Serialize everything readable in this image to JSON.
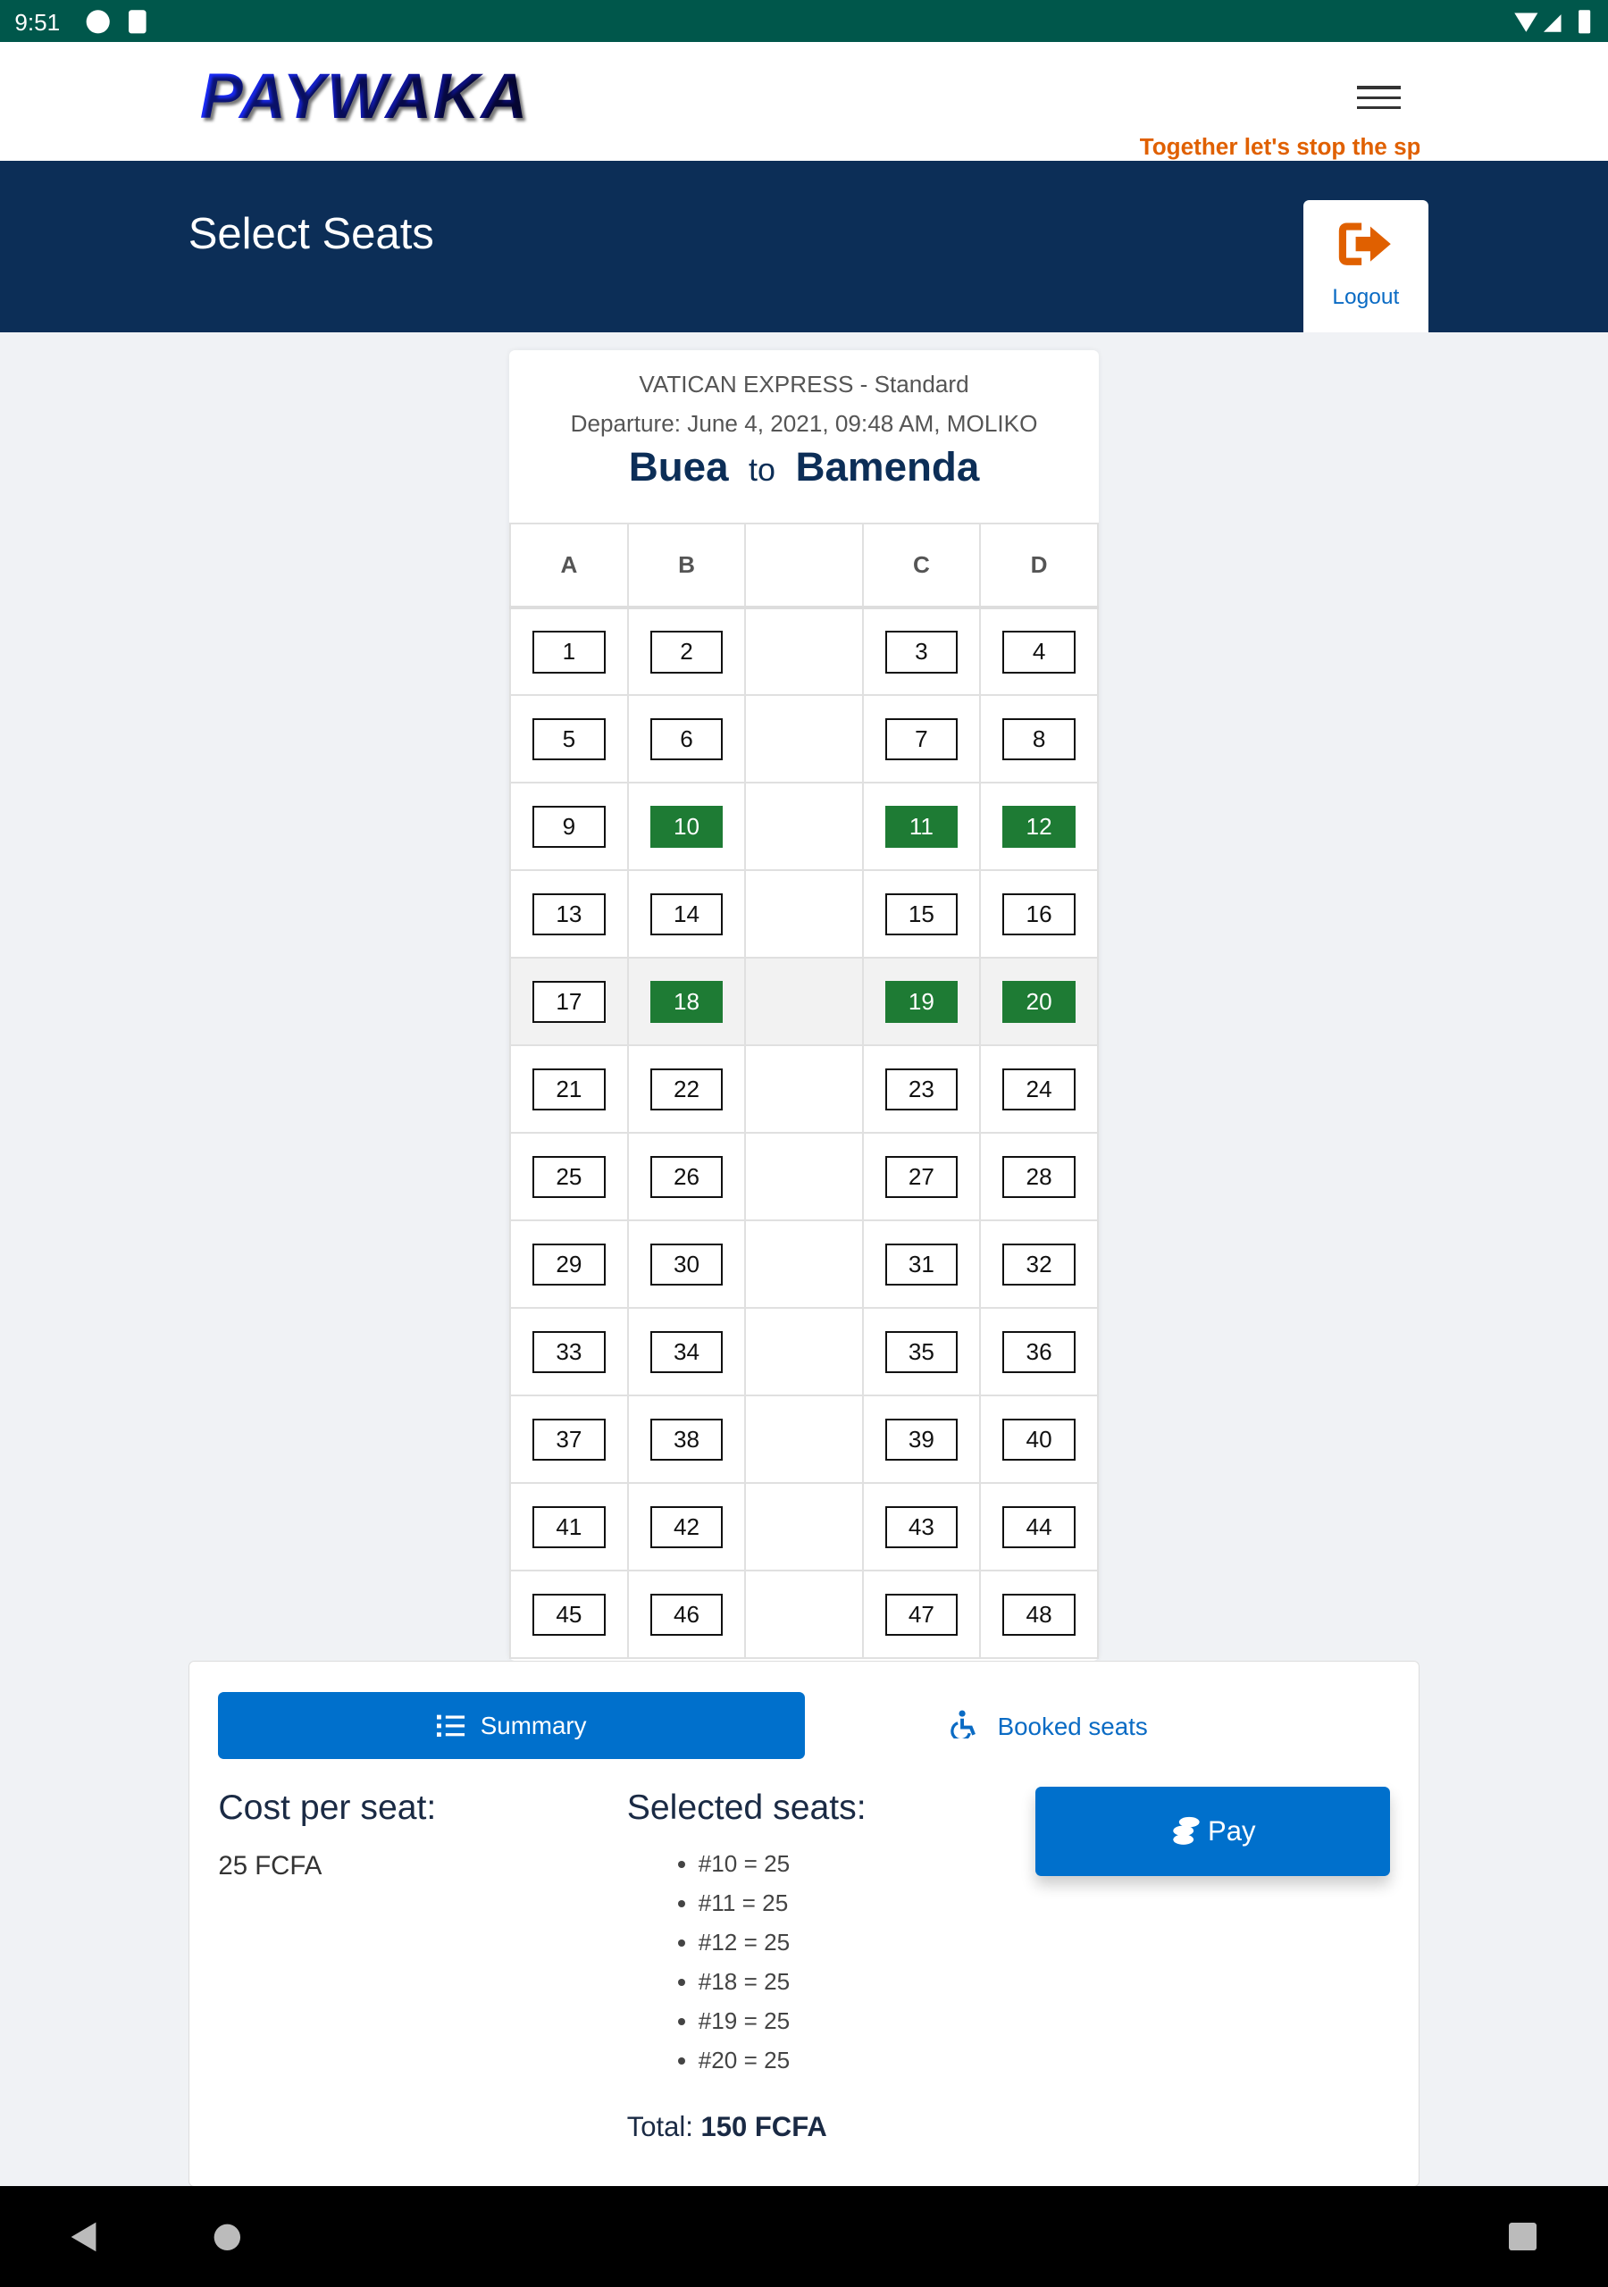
{
  "status_bar": {
    "time": "9:51"
  },
  "header": {
    "logo": "PAYWAKA",
    "tagline": "Together let's stop the spread",
    "menu_icon": "hamburger-icon"
  },
  "band": {
    "title": "Select Seats",
    "logout_label": "Logout",
    "logout_icon": "sign-out-icon"
  },
  "trip": {
    "bus": "VATICAN EXPRESS - Standard",
    "departure": "Departure: June 4, 2021, 09:48 AM, MOLIKO",
    "from": "Buea",
    "to_word": "to",
    "to": "Bamenda"
  },
  "seat_map": {
    "columns": [
      "A",
      "B",
      "",
      "C",
      "D"
    ],
    "rows": [
      [
        1,
        2,
        3,
        4
      ],
      [
        5,
        6,
        7,
        8
      ],
      [
        9,
        10,
        11,
        12
      ],
      [
        13,
        14,
        15,
        16
      ],
      [
        17,
        18,
        19,
        20
      ],
      [
        21,
        22,
        23,
        24
      ],
      [
        25,
        26,
        27,
        28
      ],
      [
        29,
        30,
        31,
        32
      ],
      [
        33,
        34,
        35,
        36
      ],
      [
        37,
        38,
        39,
        40
      ],
      [
        41,
        42,
        43,
        44
      ],
      [
        45,
        46,
        47,
        48
      ]
    ],
    "selected": [
      10,
      11,
      12,
      18,
      19,
      20
    ],
    "selected_color": "#1e7b34"
  },
  "summary": {
    "summary_label": "Summary",
    "booked_label": "Booked seats",
    "cost_heading": "Cost per seat:",
    "cost_value": "25 FCFA",
    "selected_heading": "Selected seats:",
    "selected_items": [
      "#10 = 25",
      "#11 = 25",
      "#12 = 25",
      "#18 = 25",
      "#19 = 25",
      "#20 = 25"
    ],
    "total_label": "Total:",
    "total_value": "150 FCFA",
    "pay_label": "Pay"
  },
  "colors": {
    "primary": "#0070cc",
    "navy": "#0c2e57",
    "accent": "#e06000",
    "status": "#00574b"
  }
}
